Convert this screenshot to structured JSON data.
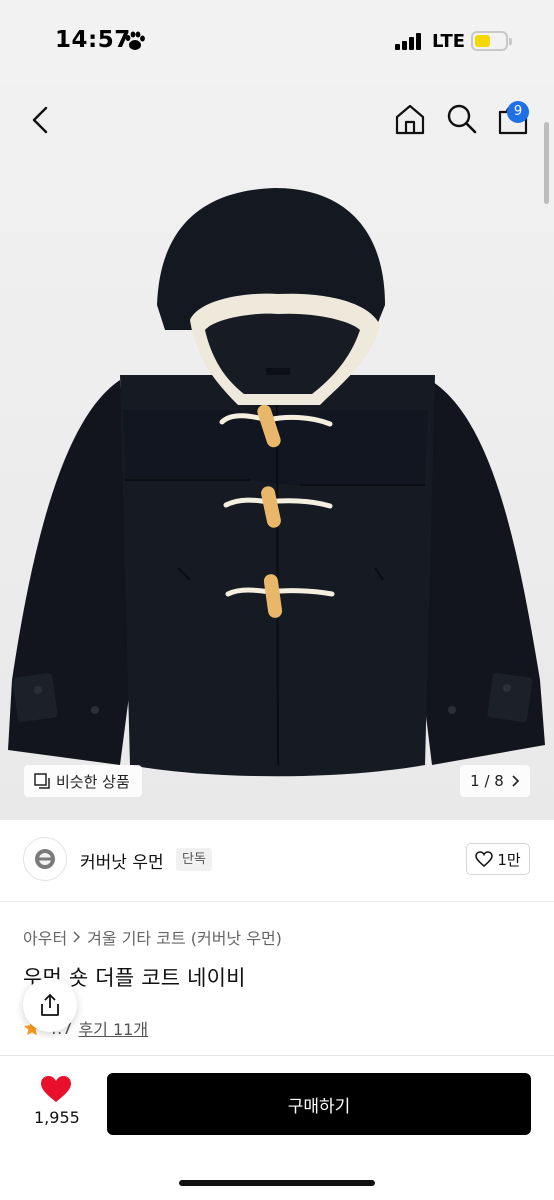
{
  "status_bar": {
    "time": "14:57",
    "network": "LTE"
  },
  "header": {
    "cart_count": "9"
  },
  "gallery": {
    "similar_label": "비슷한 상품",
    "page_indicator": "1 / 8"
  },
  "brand": {
    "name": "커버낫 우먼",
    "badge": "단독",
    "like_label": "1만"
  },
  "product": {
    "breadcrumb": [
      "아우터",
      "겨울 기타 코트 (커버낫 우먼)"
    ],
    "title": "우먼 숏 더플 코트 네이비",
    "rating": "4.7",
    "review_label": "후기 11개"
  },
  "bottom_bar": {
    "like_count": "1,955",
    "buy_label": "구매하기"
  },
  "colors": {
    "accent_blue": "#1f6fe5",
    "heart_red": "#e8102a",
    "buy_button": "#000000"
  }
}
